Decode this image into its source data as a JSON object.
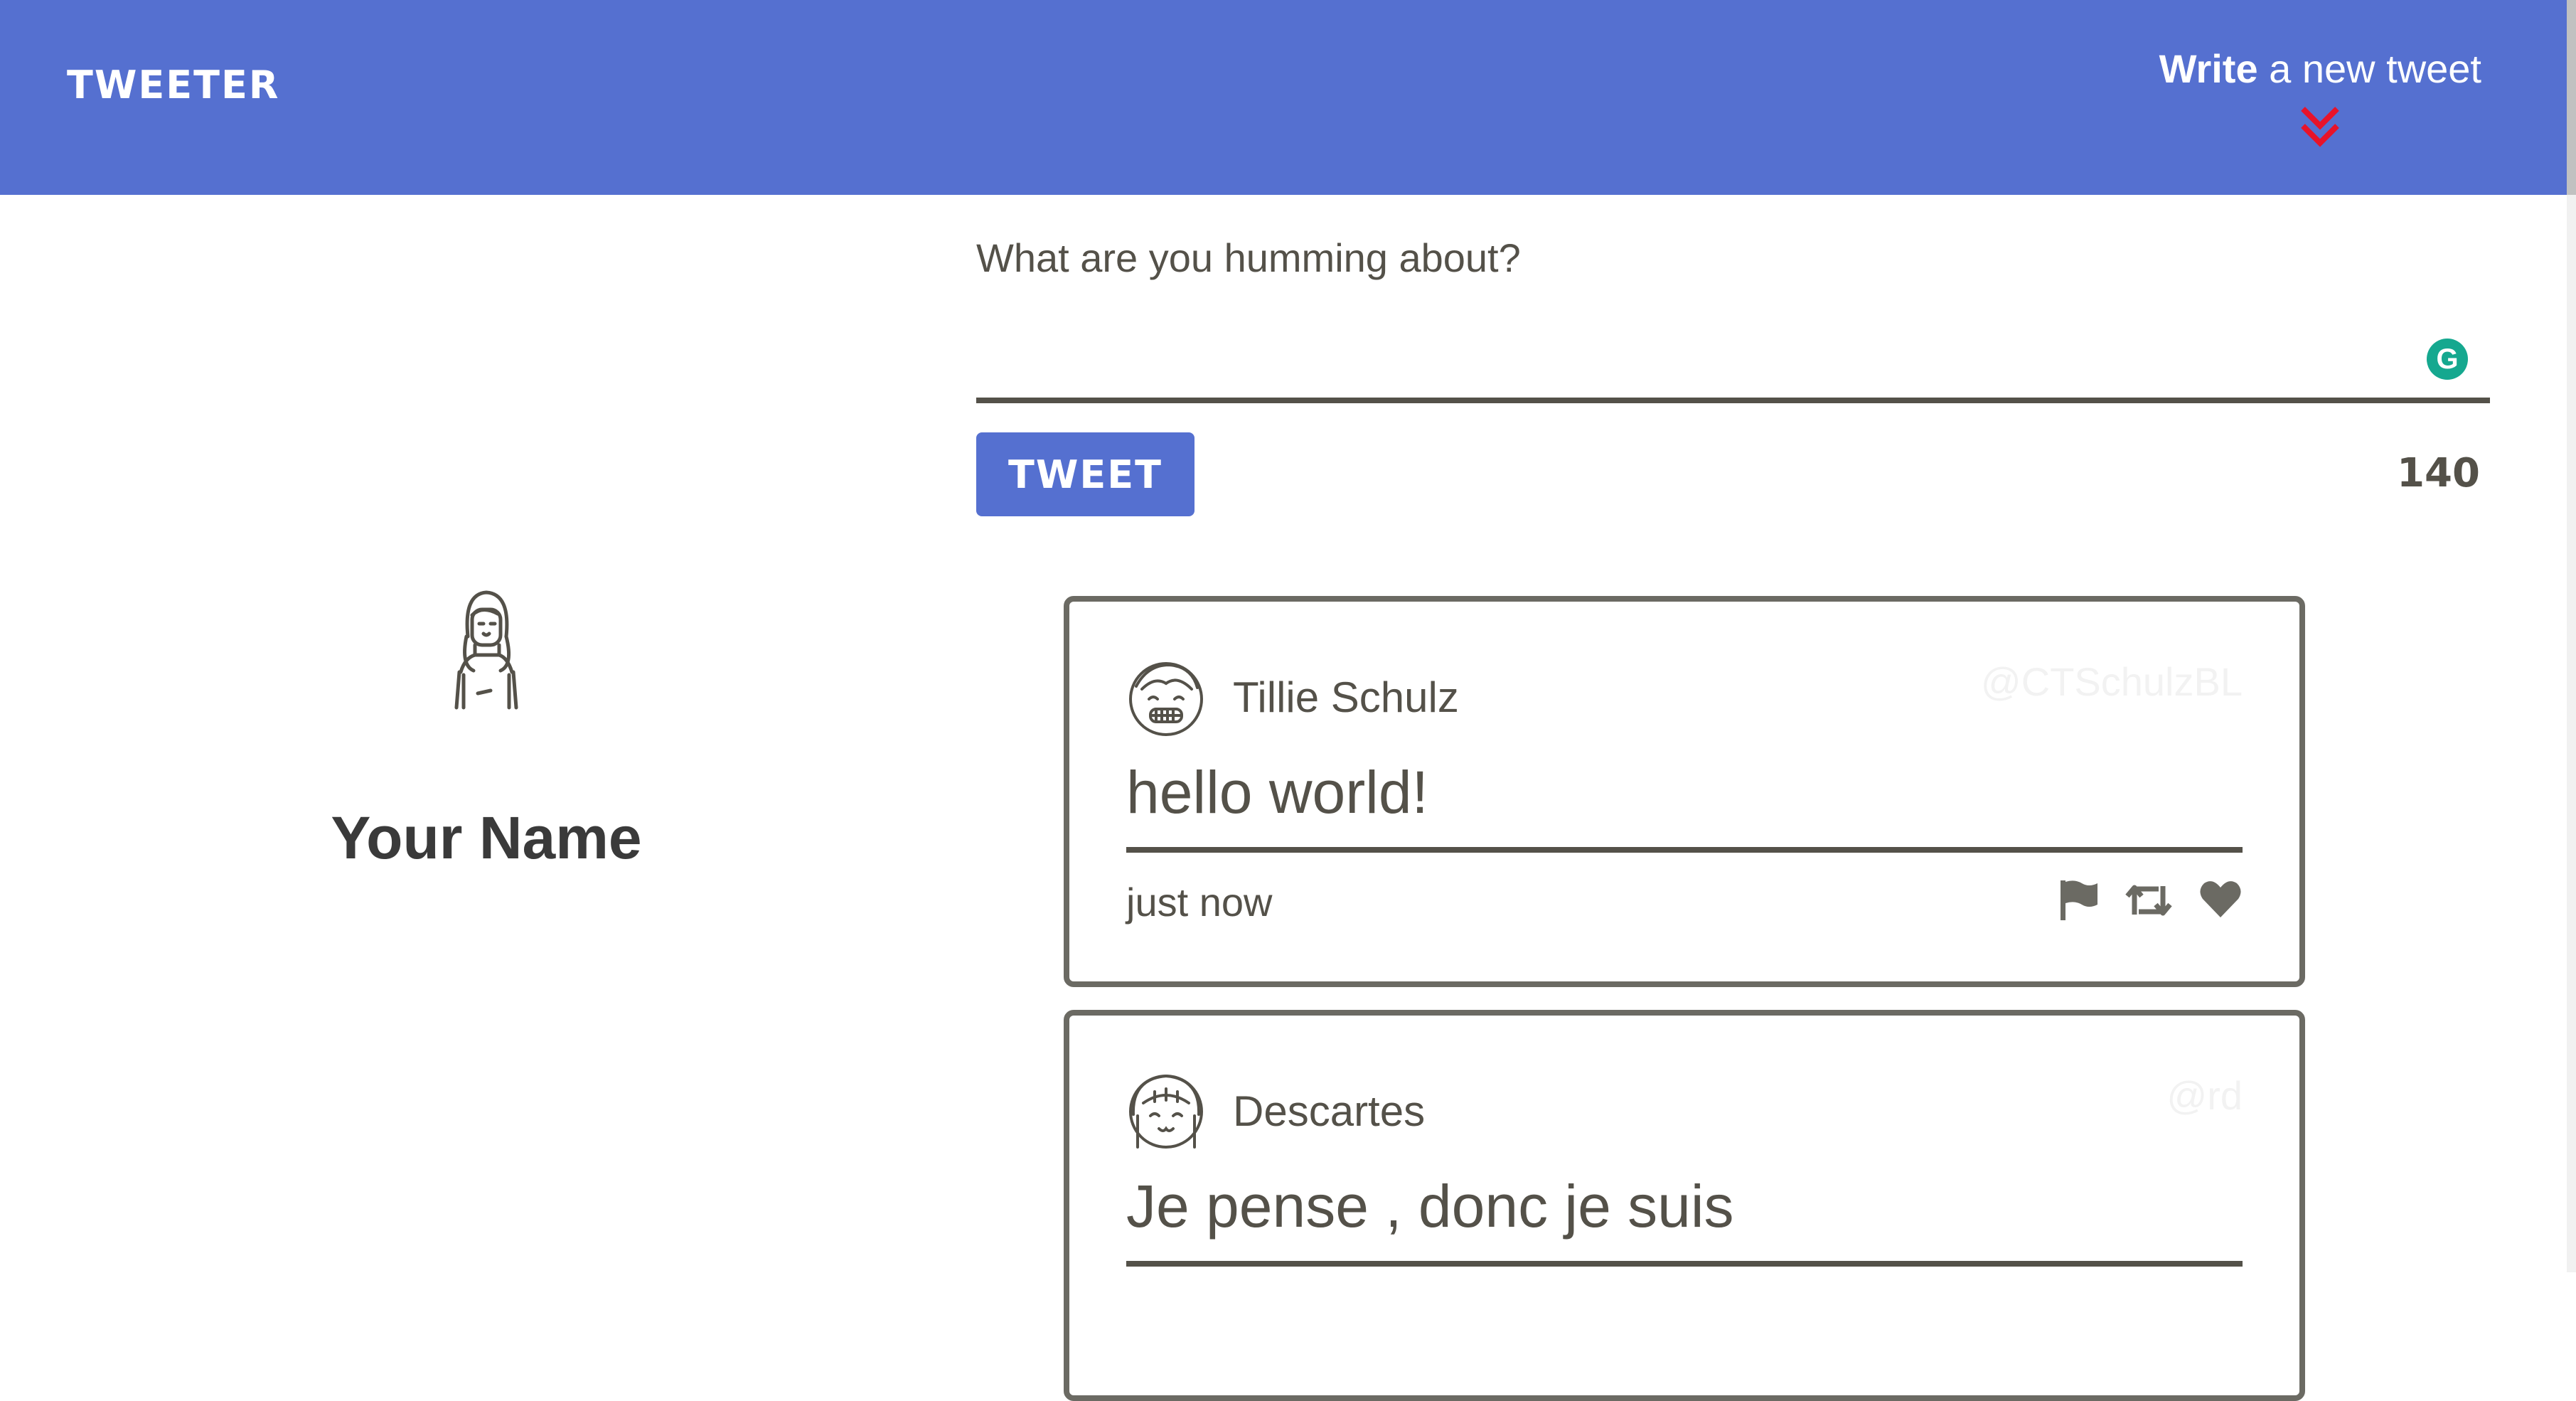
{
  "nav": {
    "brand": "TWEETER",
    "write_bold": "Write",
    "write_rest": " a new tweet",
    "chevron_icon": "double-chevron-down-icon",
    "accent_color": "#5570d0",
    "chevron_color": "#e8132a"
  },
  "sidebar": {
    "avatar_icon": "user-avatar-icon",
    "name": "Your Name"
  },
  "composer": {
    "label": "What are you humming about?",
    "value": "",
    "grammarly_icon": "grammarly-icon",
    "tweet_button": "TWEET",
    "counter": "140"
  },
  "tweets": [
    {
      "user": "Tillie Schulz",
      "handle": "@CTSchulzBL",
      "text": "hello world!",
      "time": "just now",
      "avatar_icon": "grinning-avatar-icon",
      "actions": [
        "flag-icon",
        "retweet-icon",
        "heart-icon"
      ]
    },
    {
      "user": "Descartes",
      "handle": "@rd",
      "text": "Je pense , donc je suis",
      "avatar_icon": "smiling-avatar-icon"
    }
  ]
}
